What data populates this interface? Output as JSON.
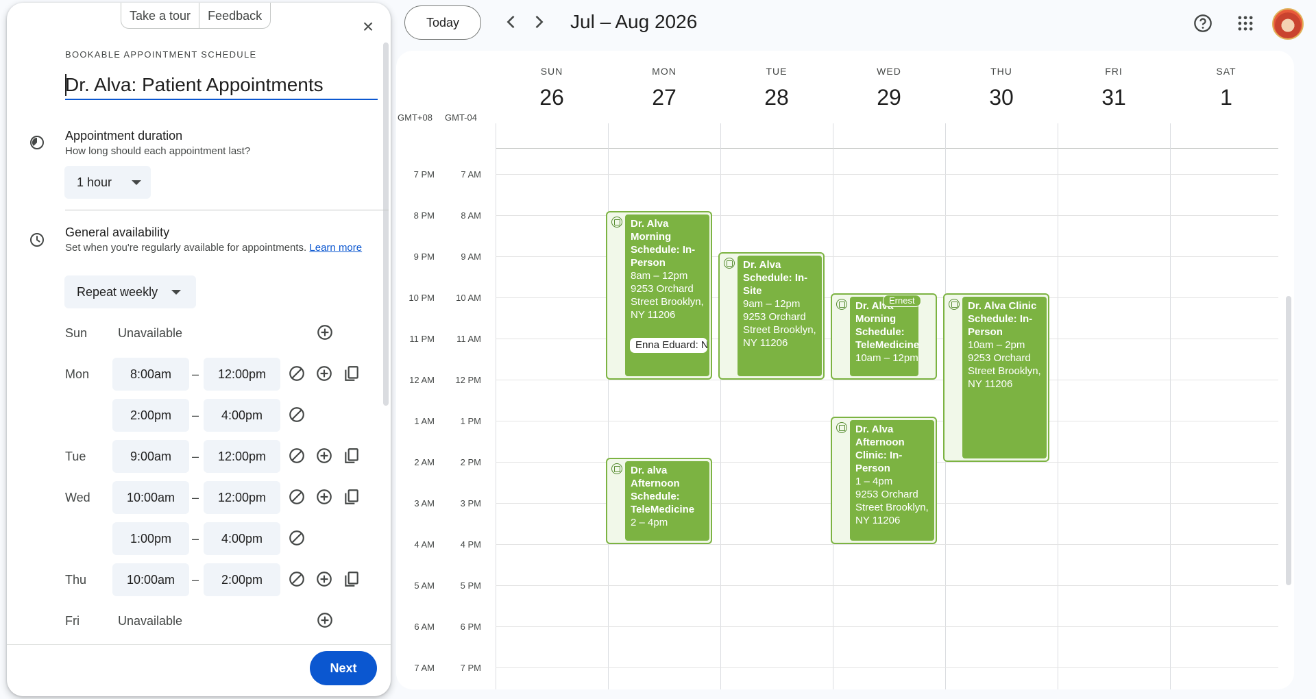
{
  "panel": {
    "tabs": [
      "Take a tour",
      "Feedback"
    ],
    "overline": "BOOKABLE APPOINTMENT SCHEDULE",
    "title": "Dr. Alva: Patient Appointments",
    "duration": {
      "title": "Appointment duration",
      "subtitle": "How long should each appointment last?",
      "value": "1 hour"
    },
    "availability": {
      "title": "General availability",
      "subtitle": "Set when you're regularly available for appointments.",
      "link": "Learn more",
      "repeat": "Repeat weekly"
    },
    "days": [
      {
        "day": "Sun",
        "unavailable": "Unavailable"
      },
      {
        "day": "Mon",
        "slots": [
          {
            "start": "8:00am",
            "end": "12:00pm"
          },
          {
            "start": "2:00pm",
            "end": "4:00pm"
          }
        ]
      },
      {
        "day": "Tue",
        "slots": [
          {
            "start": "9:00am",
            "end": "12:00pm"
          }
        ]
      },
      {
        "day": "Wed",
        "slots": [
          {
            "start": "10:00am",
            "end": "12:00pm"
          },
          {
            "start": "1:00pm",
            "end": "4:00pm"
          }
        ]
      },
      {
        "day": "Thu",
        "slots": [
          {
            "start": "10:00am",
            "end": "2:00pm"
          }
        ]
      },
      {
        "day": "Fri",
        "unavailable": "Unavailable"
      }
    ],
    "dash": "–",
    "next_label": "Next"
  },
  "topbar": {
    "today_label": "Today",
    "date_range": "Jul – Aug 2026"
  },
  "calendar": {
    "timezones": [
      "GMT+08",
      "GMT-04"
    ],
    "columns": [
      {
        "dow": "SUN",
        "date": "26"
      },
      {
        "dow": "MON",
        "date": "27"
      },
      {
        "dow": "TUE",
        "date": "28"
      },
      {
        "dow": "WED",
        "date": "29"
      },
      {
        "dow": "THU",
        "date": "30"
      },
      {
        "dow": "FRI",
        "date": "31"
      },
      {
        "dow": "SAT",
        "date": "1"
      }
    ],
    "hours_gmt8": [
      "7 PM",
      "8 PM",
      "9 PM",
      "10 PM",
      "11 PM",
      "12 AM",
      "1 AM",
      "2 AM",
      "3 AM",
      "4 AM",
      "5 AM",
      "6 AM",
      "7 AM"
    ],
    "hours_local": [
      "7 AM",
      "8 AM",
      "9 AM",
      "10 AM",
      "11 AM",
      "12 PM",
      "1 PM",
      "2 PM",
      "3 PM",
      "4 PM",
      "5 PM",
      "6 PM",
      "7 PM"
    ],
    "events": [
      {
        "title": "Dr. Alva Morning Schedule: In-Person",
        "time": "8am – 12pm",
        "location": "9253 Orchard Street Brooklyn, NY 11206",
        "chip": "Enna Eduard: N"
      },
      {
        "title": "Dr. Alva Schedule: In-Site",
        "time": "9am – 12pm",
        "location": "9253 Orchard Street Brooklyn, NY 11206"
      },
      {
        "title": "Dr. Alva Morning Schedule: TeleMedicine",
        "time": "10am – 12pm",
        "tag": "Ernest"
      },
      {
        "title": "Dr. Alva Clinic Schedule: In-Person",
        "time": "10am – 2pm",
        "location": "9253 Orchard Street Brooklyn, NY 11206"
      },
      {
        "title": "Dr. alva Afternoon Schedule: TeleMedicine",
        "time": "2 – 4pm"
      },
      {
        "title": "Dr. Alva Afternoon Clinic: In-Person",
        "time": "1 – 4pm",
        "location": "9253 Orchard Street Brooklyn, NY 11206"
      }
    ]
  }
}
